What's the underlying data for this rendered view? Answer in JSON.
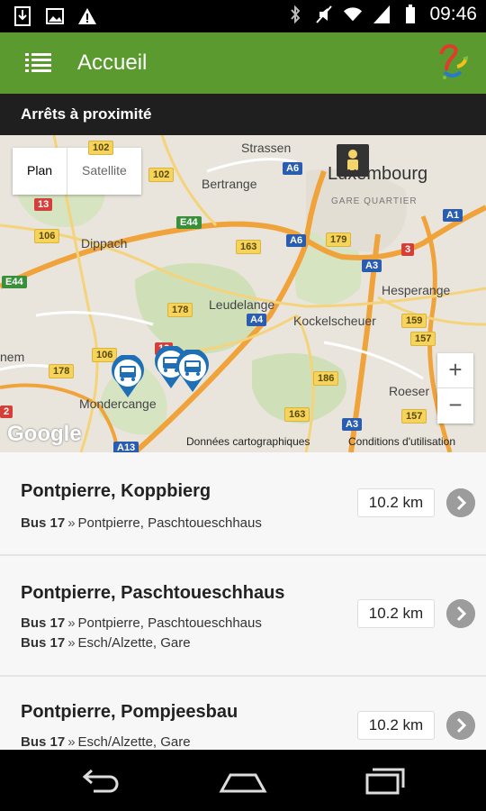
{
  "status_bar": {
    "time": "09:46",
    "left_icons": [
      "download-icon",
      "image-icon",
      "warning-icon"
    ],
    "right_icons": [
      "bluetooth-icon",
      "mute-icon",
      "wifi-icon",
      "signal-icon",
      "battery-icon"
    ]
  },
  "app_bar": {
    "title": "Accueil",
    "menu_icon": "list-menu-icon",
    "logo_icon": "app-logo-icon"
  },
  "section": {
    "title": "Arrêts à proximité"
  },
  "map": {
    "type_controls": {
      "plan": "Plan",
      "satellite": "Satellite",
      "selected": "Plan"
    },
    "zoom_in": "+",
    "zoom_out": "−",
    "google_logo": "Google",
    "credit": "Données cartographiques",
    "terms": "Conditions d'utilisation",
    "places": {
      "strassen": "Strassen",
      "luxembourg": "Luxembourg",
      "gare_quartier": "GARE QUARTIER",
      "bertrange": "Bertrange",
      "dippach": "Dippach",
      "hesperange": "Hesperange",
      "leudelange": "Leudelange",
      "kockelscheuer": "Kockelscheuer",
      "mondercange": "Mondercange",
      "roeser": "Roeser",
      "nem": "nem"
    },
    "shields": {
      "s102a": "102",
      "s102b": "102",
      "s13": "13",
      "sE44a": "E44",
      "sA6a": "A6",
      "s106": "106",
      "s163a": "163",
      "sA6b": "A6",
      "s179": "179",
      "s3": "3",
      "sA1": "A1",
      "sA3a": "A3",
      "sE44b": "E44",
      "s178a": "178",
      "sA4": "A4",
      "s159": "159",
      "s106b": "106",
      "s157a": "157",
      "s13b": "13",
      "s178b": "178",
      "s186": "186",
      "s2": "2",
      "s163b": "163",
      "sA13": "A13",
      "sA3b": "A3",
      "s157b": "157"
    }
  },
  "stops": [
    {
      "name": "Pontpierre, Koppbierg",
      "distance": "10.2 km",
      "routes": [
        {
          "line": "Bus 17",
          "destination": "Pontpierre, Paschtoueschhaus"
        }
      ]
    },
    {
      "name": "Pontpierre, Paschtoueschhaus",
      "distance": "10.2 km",
      "routes": [
        {
          "line": "Bus 17",
          "destination": "Pontpierre, Paschtoueschhaus"
        },
        {
          "line": "Bus 17",
          "destination": "Esch/Alzette, Gare"
        }
      ]
    },
    {
      "name": "Pontpierre, Pompjeesbau",
      "distance": "10.2 km",
      "routes": [
        {
          "line": "Bus 17",
          "destination": "Esch/Alzette, Gare"
        }
      ]
    }
  ],
  "nav_bar": {
    "back": "back-icon",
    "home": "home-icon",
    "recents": "recents-icon"
  },
  "colors": {
    "app_bar": "#5a9a2e",
    "section_bar": "#1f1f1f",
    "marker": "#1e6fb5"
  }
}
